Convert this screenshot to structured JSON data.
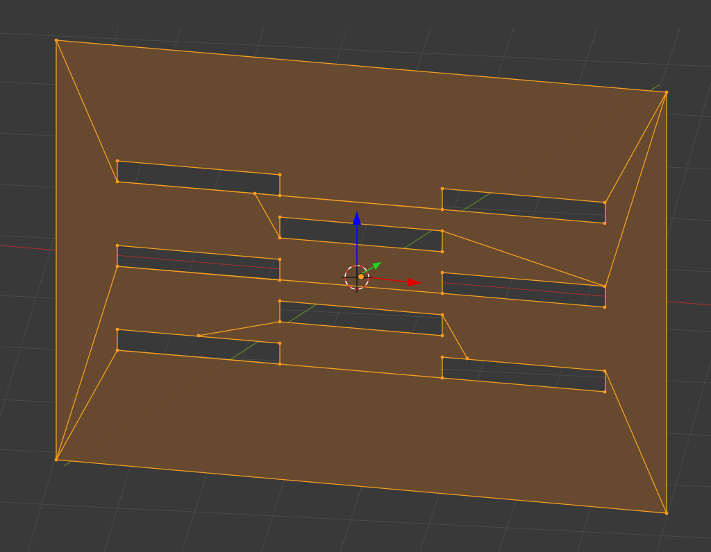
{
  "viewport": {
    "background": "#393939",
    "grid_color": "#4a4a4a",
    "x_axis_color": "#9a3030",
    "y_axis_color": "#5e8a2c",
    "mesh_fill": "#6a4b2f",
    "hole_fill": "#3b3b3b",
    "edge_color": "#f5a021",
    "vertex_color": "#ff9a1f"
  },
  "gizmo": {
    "z_color": "#0000ff",
    "y_color": "#1fd61f",
    "x_color": "#e00000",
    "cursor_color": "#ffffff",
    "cursor_accent": "#e03030",
    "origin_color": "#f5a021"
  }
}
